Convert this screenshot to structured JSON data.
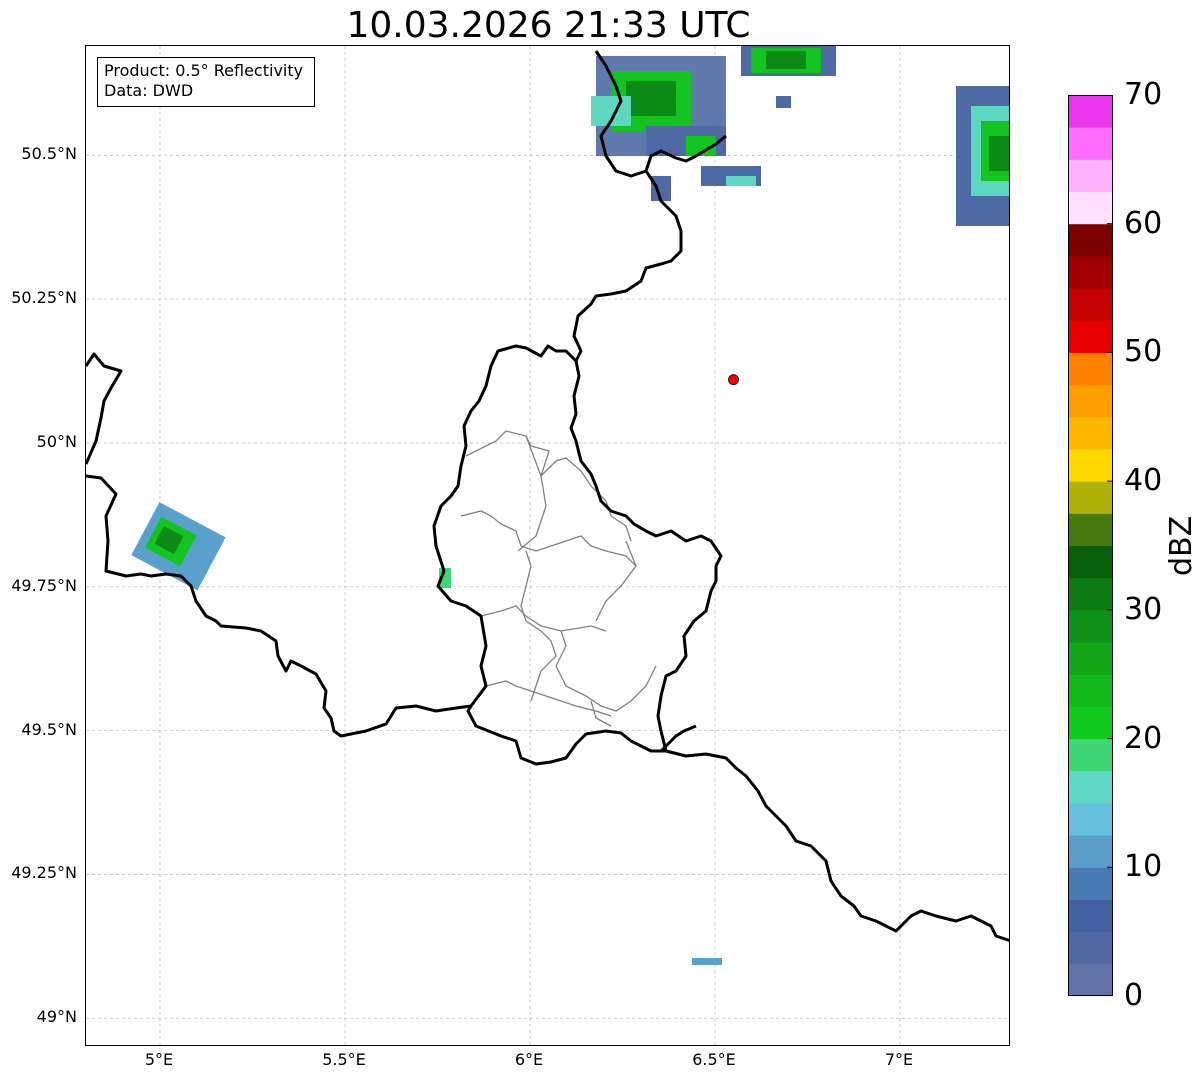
{
  "title": "10.03.2026 21:33 UTC",
  "info": {
    "product": "Product: 0.5° Reflectivity",
    "data": "Data: DWD"
  },
  "map": {
    "lon_range": [
      4.8,
      7.3
    ],
    "lat_range": [
      48.95,
      50.69
    ],
    "lat_ticks": [
      {
        "value": 50.5,
        "label": "50.5°N"
      },
      {
        "value": 50.25,
        "label": "50.25°N"
      },
      {
        "value": 50.0,
        "label": "50°N"
      },
      {
        "value": 49.75,
        "label": "49.75°N"
      },
      {
        "value": 49.5,
        "label": "49.5°N"
      },
      {
        "value": 49.25,
        "label": "49.25°N"
      },
      {
        "value": 49.0,
        "label": "49°N"
      }
    ],
    "lon_ticks": [
      {
        "value": 5.0,
        "label": "5°E"
      },
      {
        "value": 5.5,
        "label": "5.5°E"
      },
      {
        "value": 6.0,
        "label": "6°E"
      },
      {
        "value": 6.5,
        "label": "6.5°E"
      },
      {
        "value": 7.0,
        "label": "7°E"
      }
    ],
    "marker": {
      "lon": 6.55,
      "lat": 50.11,
      "color": "#ff0000"
    },
    "border_color": "#000000",
    "district_color": "#808080",
    "grid": true
  },
  "colorbar": {
    "unit": "dBZ",
    "min": 0,
    "max": 70,
    "tick_labels": [
      {
        "value": 0,
        "label": "0"
      },
      {
        "value": 10,
        "label": "10"
      },
      {
        "value": 20,
        "label": "20"
      },
      {
        "value": 30,
        "label": "30"
      },
      {
        "value": 40,
        "label": "40"
      },
      {
        "value": 50,
        "label": "50"
      },
      {
        "value": 60,
        "label": "60"
      },
      {
        "value": 70,
        "label": "70"
      }
    ],
    "colors": [
      "#6473a7",
      "#5068a4",
      "#4261a5",
      "#4a7ab3",
      "#5a9dc8",
      "#65c1dc",
      "#62d9c6",
      "#3ed676",
      "#11c91c",
      "#12b81c",
      "#13a617",
      "#0f9117",
      "#0c7c12",
      "#085e0b",
      "#47790c",
      "#b0b20a",
      "#ffd800",
      "#ffb800",
      "#ff9c00",
      "#ff7f00",
      "#e80000",
      "#c50000",
      "#a00000",
      "#7c0000",
      "#ffe0ff",
      "#ffb3ff",
      "#ff6cff",
      "#ea37ef"
    ]
  },
  "radar_colors": {
    "weak": "#4e6aa4",
    "light": "#5aa0cc",
    "cyan": "#5ed7c0",
    "green": "#13c420",
    "dark_green": "#0b8a15"
  }
}
